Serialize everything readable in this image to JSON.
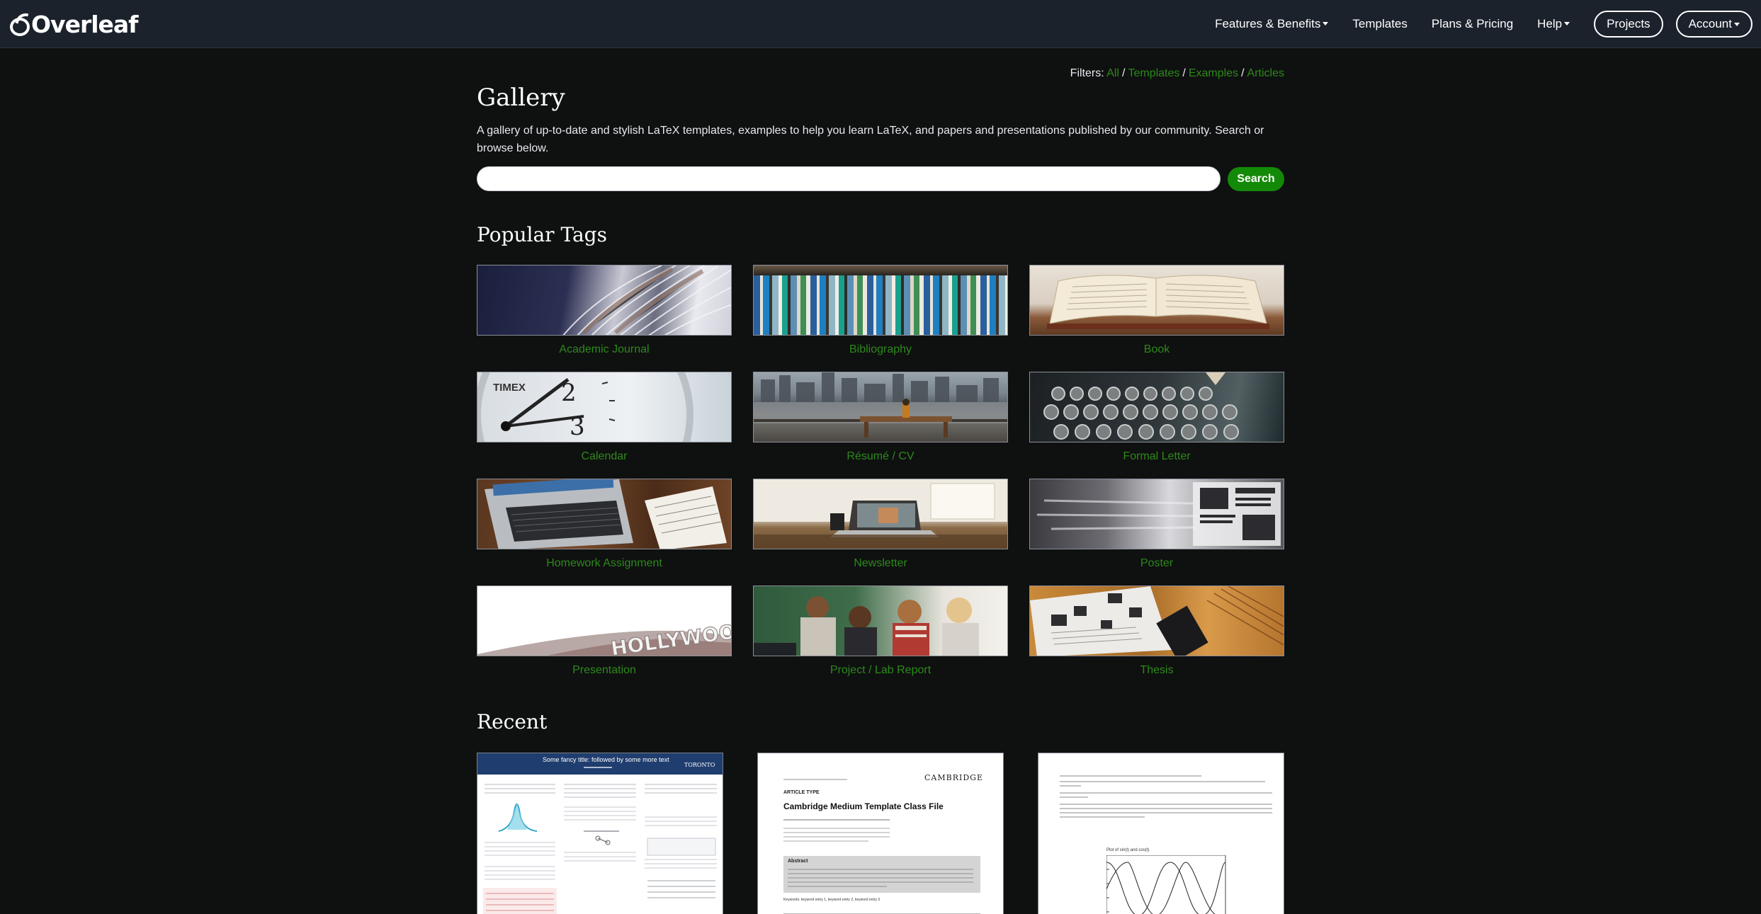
{
  "nav": {
    "brand": "Overleaf",
    "links": [
      "Features & Benefits",
      "Templates",
      "Plans & Pricing",
      "Help"
    ],
    "projects": "Projects",
    "account": "Account"
  },
  "filters": {
    "label": "Filters:",
    "items": [
      "All",
      "Templates",
      "Examples",
      "Articles"
    ]
  },
  "gallery": {
    "title": "Gallery",
    "intro": "A gallery of up-to-date and stylish LaTeX templates, examples to help you learn LaTeX, and papers and presentations published by our community. Search or browse below.",
    "search_button": "Search",
    "search_value": ""
  },
  "popular_tags": {
    "title": "Popular Tags",
    "tags": [
      "Academic Journal",
      "Bibliography",
      "Book",
      "Calendar",
      "Résumé / CV",
      "Formal Letter",
      "Homework Assignment",
      "Newsletter",
      "Poster",
      "Presentation",
      "Project / Lab Report",
      "Thesis"
    ]
  },
  "recent": {
    "title": "Recent",
    "cards": [
      {
        "header": "Some fancy title: followed by some more text",
        "logo": "TORONTO"
      },
      {
        "press": "CAMBRIDGE",
        "article_type": "ARTICLE TYPE",
        "title": "Cambridge Medium Template Class File",
        "abstract_label": "Abstract",
        "keywords": "Keywords: keyword entry 1, keyword entry 2, keyword entry 3"
      },
      {
        "plot_title": "Plot of sin(t) and cos(t)"
      }
    ]
  },
  "colors": {
    "navbar": "#1b222c",
    "background": "#0f1010",
    "link_green": "#2c8a1b",
    "button_green": "#138a07"
  }
}
